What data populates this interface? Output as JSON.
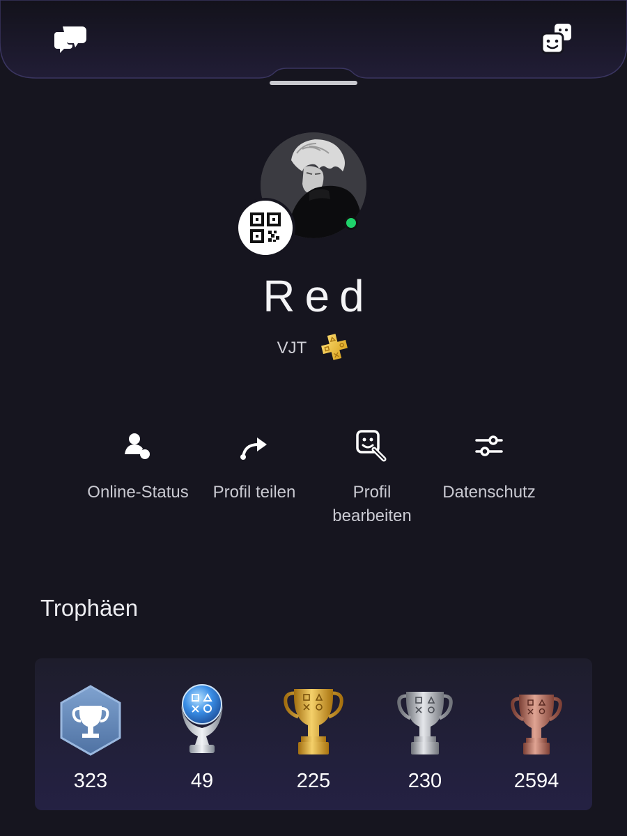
{
  "header": {
    "left_icon": "chat-bubbles-icon",
    "right_icon": "game-lists-icon"
  },
  "profile": {
    "name": "Red",
    "online_id": "VJT",
    "online_status": "online",
    "plus_badge": "ps-plus-icon",
    "status_color": "#1fd26a"
  },
  "actions": [
    {
      "label": "Online-Status",
      "icon": "online-status-icon"
    },
    {
      "label": "Profil teilen",
      "icon": "share-arrow-icon"
    },
    {
      "label": "Profil\nbearbeiten",
      "icon": "edit-profile-icon"
    },
    {
      "label": "Datenschutz",
      "icon": "privacy-sliders-icon"
    }
  ],
  "trophies": {
    "section_title": "Trophäen",
    "items": [
      {
        "kind": "level",
        "count": "323",
        "icon": "trophy-level-icon"
      },
      {
        "kind": "platinum",
        "count": "49",
        "icon": "platinum-trophy-icon"
      },
      {
        "kind": "gold",
        "count": "225",
        "icon": "gold-trophy-icon"
      },
      {
        "kind": "silver",
        "count": "230",
        "icon": "silver-trophy-icon"
      },
      {
        "kind": "bronze",
        "count": "2594",
        "icon": "bronze-trophy-icon"
      }
    ]
  },
  "colors": {
    "background": "#16151f",
    "gold": "#d6a52c",
    "silver": "#a9abb3",
    "bronze": "#b9776a",
    "platinum": "#5aa0e8",
    "level": "#6a8fc0"
  }
}
